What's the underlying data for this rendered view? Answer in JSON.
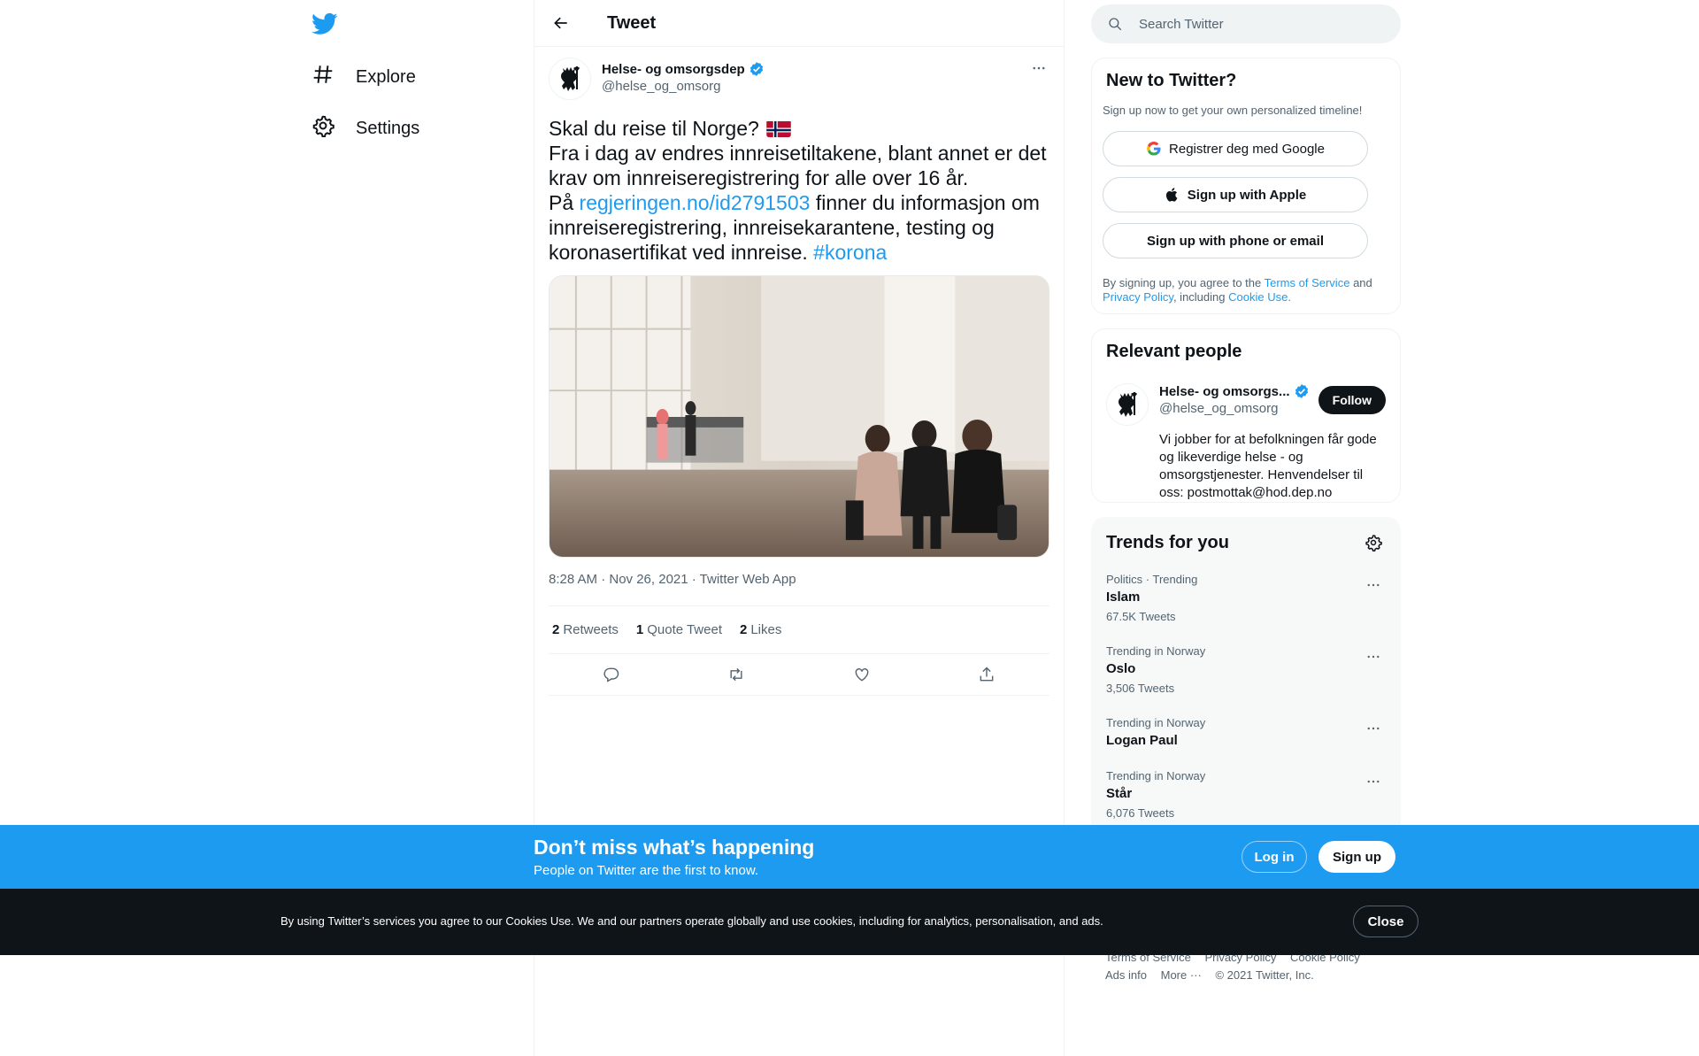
{
  "nav": {
    "logo_icon": "twitter-bird-icon",
    "items": [
      {
        "label": "Explore",
        "icon": "hashtag-icon"
      },
      {
        "label": "Settings",
        "icon": "gear-icon"
      }
    ]
  },
  "header": {
    "title": "Tweet"
  },
  "tweet": {
    "author_name": "Helse- og omsorgsdep",
    "author_handle": "@helse_og_omsorg",
    "text_line1": "Skal du reise til Norge?",
    "text_line2": "Fra i dag av endres innreisetiltakene, blant annet er det krav om innreiseregistrering for alle over 16 år.",
    "text_line3_pre": "På",
    "link": "regjeringen.no/id2791503",
    "text_line3_post": "finner du informasjon om innreiseregistrering, innreisekarantene, testing og koronasertifikat ved innreise.",
    "hashtag": "#korona",
    "timestamp": "8:28 AM · Nov 26, 2021 · Twitter Web App",
    "stats": [
      {
        "count": "2",
        "label": "Retweets"
      },
      {
        "count": "1",
        "label": "Quote Tweet"
      },
      {
        "count": "2",
        "label": "Likes"
      }
    ]
  },
  "search": {
    "placeholder": "Search Twitter"
  },
  "signup": {
    "title": "New to Twitter?",
    "subtitle": "Sign up now to get your own personalized timeline!",
    "google_label": "Registrer deg med Google",
    "apple_label": "Sign up with Apple",
    "phone_label": "Sign up with phone or email",
    "legal_pre": "By signing up, you agree to the",
    "terms": "Terms of Service",
    "and": "and",
    "privacy": "Privacy Policy",
    "including": ", including",
    "cookie": "Cookie Use."
  },
  "people": {
    "title": "Relevant people",
    "name": "Helse- og omsorgs...",
    "handle": "@helse_og_omsorg",
    "follow_label": "Follow",
    "bio": "Vi jobber for at befolkningen får gode og likeverdige helse - og omsorgstjenester. Henvendelser til oss: postmottak@hod.dep.no"
  },
  "trends": {
    "title": "Trends for you",
    "items": [
      {
        "meta": "Politics · Trending",
        "name": "Islam",
        "count": "67.5K Tweets"
      },
      {
        "meta": "Trending in Norway",
        "name": "Oslo",
        "count": "3,506 Tweets"
      },
      {
        "meta": "Trending in Norway",
        "name": "Logan Paul",
        "count": ""
      },
      {
        "meta": "Trending in Norway",
        "name": "Står",
        "count": "6,076 Tweets"
      }
    ]
  },
  "footer": {
    "terms": "Terms of Service",
    "privacy": "Privacy Policy",
    "cookie": "Cookie Policy",
    "ads": "Ads info",
    "more": "More ···",
    "copyright": "© 2021 Twitter, Inc."
  },
  "login_bar": {
    "title": "Don’t miss what’s happening",
    "subtitle": "People on Twitter are the first to know.",
    "login_label": "Log in",
    "signup_label": "Sign up"
  },
  "cookie_bar": {
    "text": "By using Twitter’s services you agree to our Cookies Use. We and our partners operate globally and use cookies, including for analytics, personalisation, and ads.",
    "close_label": "Close"
  },
  "colors": {
    "accent": "#1d9bf0",
    "text": "#0f1419",
    "secondary": "#536471",
    "verified": "#1d9bf0"
  }
}
